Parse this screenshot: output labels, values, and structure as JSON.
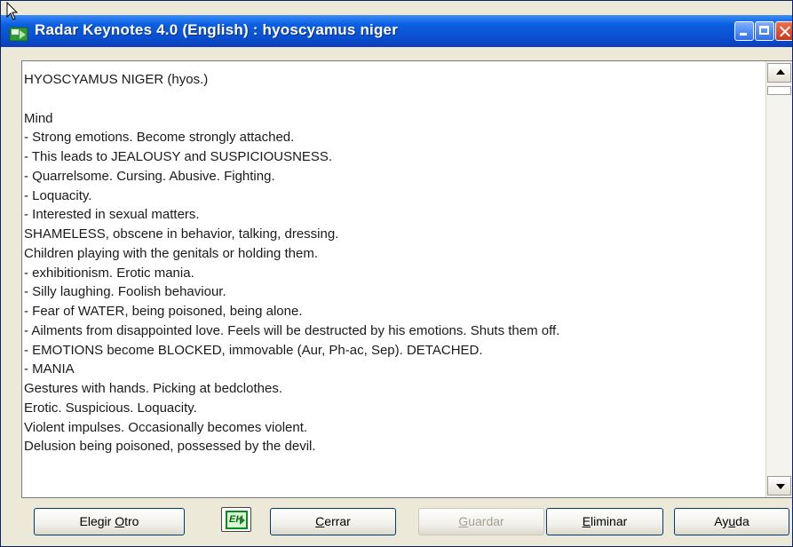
{
  "window": {
    "title": "Radar Keynotes 4.0 (English) : hyoscyamus niger"
  },
  "content": {
    "lines": [
      "HYOSCYAMUS NIGER (hyos.)",
      "",
      "Mind",
      "- Strong emotions. Become strongly attached.",
      "- This leads to JEALOUSY and SUSPICIOUSNESS.",
      "- Quarrelsome. Cursing. Abusive. Fighting.",
      "- Loquacity.",
      "- Interested in sexual matters.",
      "SHAMELESS, obscene in behavior, talking, dressing.",
      "Children playing with the genitals or holding them.",
      "- exhibitionism. Erotic mania.",
      "- Silly laughing. Foolish behaviour.",
      "- Fear of WATER, being poisoned, being alone.",
      "- Ailments from disappointed love. Feels will be destructed by his emotions. Shuts them off.",
      "- EMOTIONS become BLOCKED, immovable (Aur, Ph-ac, Sep). DETACHED.",
      "- MANIA",
      "Gestures with hands. Picking at bedclothes.",
      "Erotic. Suspicious. Loquacity.",
      "Violent impulses. Occasionally becomes violent.",
      "Delusion being poisoned, possessed by the devil."
    ]
  },
  "buttons": {
    "elegir": {
      "pre": "Elegir ",
      "mn": "O",
      "post": "tro"
    },
    "eh_icon_label": "EH",
    "cerrar": {
      "pre": "",
      "mn": "C",
      "post": "errar"
    },
    "guardar": {
      "pre": "",
      "mn": "G",
      "post": "uardar"
    },
    "eliminar": {
      "pre": "",
      "mn": "E",
      "post": "liminar"
    },
    "ayuda": {
      "pre": "Ay",
      "mn": "u",
      "post": "da"
    }
  },
  "colors": {
    "titlebar": "#0a5fe0",
    "window_bg": "#ece9d8",
    "disabled_text": "#a3a092"
  }
}
